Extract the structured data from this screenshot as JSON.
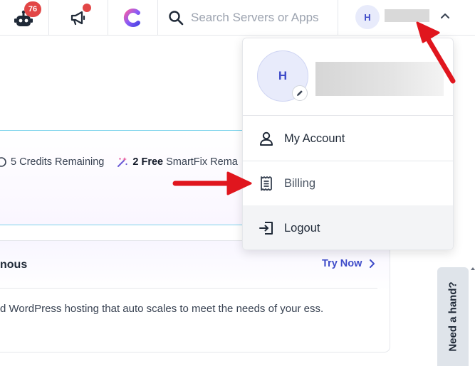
{
  "topbar": {
    "bot_badge_count": "76",
    "search": {
      "placeholder": "Search Servers or Apps",
      "value": ""
    },
    "user_initial": "H"
  },
  "dropdown": {
    "avatar_initial": "H",
    "items": [
      {
        "label": "My Account",
        "icon": "user-icon"
      },
      {
        "label": "Billing",
        "icon": "receipt-icon"
      },
      {
        "label": "Logout",
        "icon": "logout-icon"
      }
    ]
  },
  "credits": {
    "credits_text": "5 Credits Remaining",
    "smartfix_bold": "2 Free",
    "smartfix_rest": " SmartFix Rema"
  },
  "promo": {
    "title_fragment": "nous",
    "try_now_label": "Try Now",
    "description": "d WordPress hosting that auto scales to meet the needs of your ess."
  },
  "help": {
    "need_hand_label": "Need a hand?"
  },
  "colors": {
    "accent": "#3f4cc9",
    "badge_red": "#e24646",
    "annotation_red": "#e0161e"
  }
}
